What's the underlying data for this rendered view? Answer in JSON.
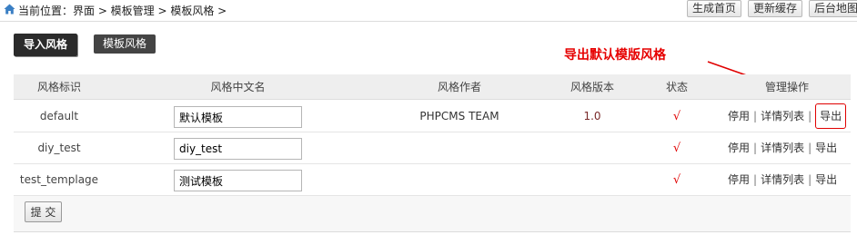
{
  "breadcrumb": {
    "text": "当前位置：界面 > 模板管理 > 模板风格 >"
  },
  "top_buttons": {
    "generate_home": "生成首页",
    "update_cache": "更新缓存",
    "backend_map": "后台地图"
  },
  "tabs": {
    "import_style": "导入风格",
    "template_style": "模板风格"
  },
  "annotation": {
    "text": "导出默认模版风格",
    "color": "#e60000"
  },
  "table": {
    "headers": [
      "风格标识",
      "风格中文名",
      "风格作者",
      "风格版本",
      "状态",
      "管理操作"
    ],
    "rows": [
      {
        "id": "default",
        "name": "默认模板",
        "author": "PHPCMS TEAM",
        "version": "1.0",
        "status": "√"
      },
      {
        "id": "diy_test",
        "name": "diy_test",
        "author": "",
        "version": "",
        "status": "√"
      },
      {
        "id": "test_templage",
        "name": "测试模板",
        "author": "",
        "version": "",
        "status": "√"
      }
    ],
    "ops": {
      "disable": "停用",
      "details": "详情列表",
      "export": "导出",
      "separator": "|"
    }
  },
  "submit_label": "提 交",
  "icons": [
    "home-icon",
    "red-arrow-icon"
  ]
}
